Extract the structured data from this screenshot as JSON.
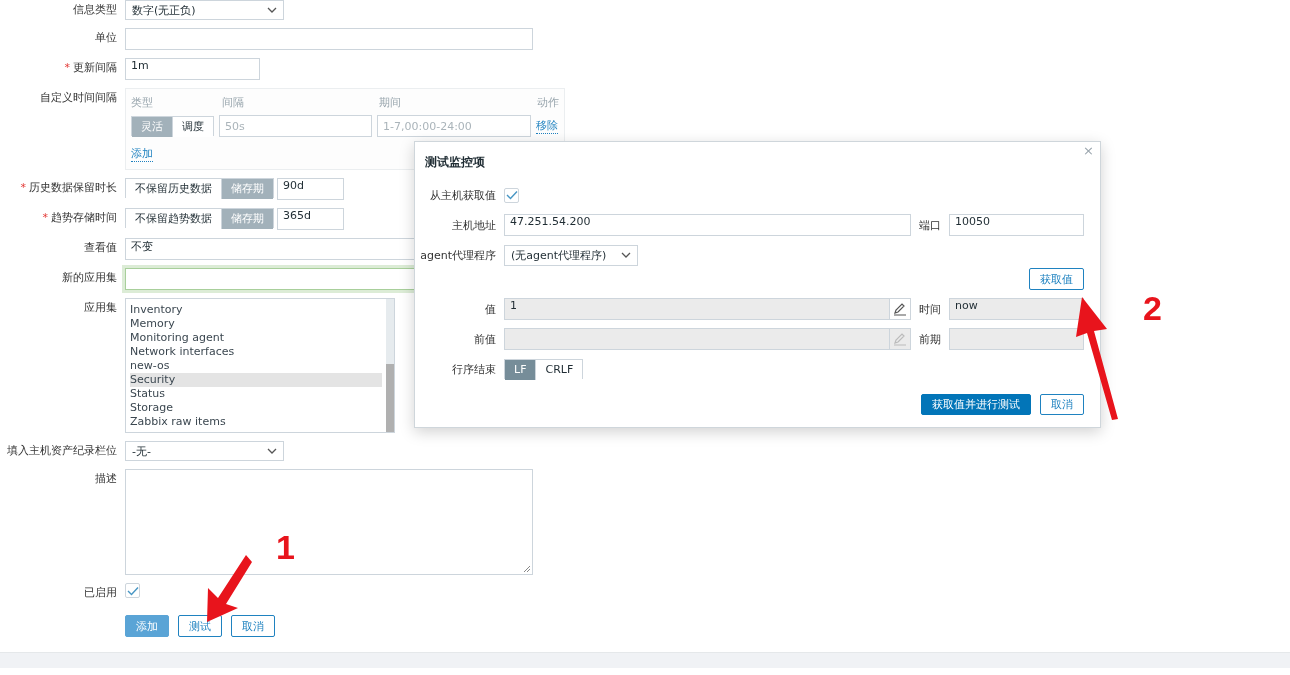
{
  "form": {
    "rows": [
      {
        "kind": "select",
        "label": "信息类型",
        "value": "数字(无正负)"
      },
      {
        "kind": "wide-input",
        "label": "单位",
        "focused": false
      },
      {
        "kind": "short-input",
        "label": "更新间隔",
        "required_mark": "*",
        "value": "1m"
      },
      {
        "kind": "intervals",
        "label": "自定义时间间隔",
        "headers": [
          "类型",
          "间隔",
          "期间",
          "动作"
        ],
        "items": [
          {
            "modes": [
              {
                "label": "灵活",
                "selected": true
              },
              {
                "label": "调度",
                "selected": false
              }
            ],
            "interval_placeholder": "50s",
            "period_placeholder": "1-7,00:00-24:00",
            "action": "移除"
          }
        ],
        "add_link": "添加"
      },
      {
        "kind": "storage",
        "label": "历史数据保留时长",
        "required_mark": "*",
        "options": [
          {
            "label": "不保留历史数据",
            "selected": false
          },
          {
            "label": "储存期",
            "selected": true
          }
        ],
        "value": "90d"
      },
      {
        "kind": "storage",
        "label": "趋势存储时间",
        "required_mark": "*",
        "options": [
          {
            "label": "不保留趋势数据",
            "selected": false
          },
          {
            "label": "储存期",
            "selected": true
          }
        ],
        "value": "365d"
      },
      {
        "kind": "wide-input",
        "label": "查看值",
        "value": "不变",
        "focused": false
      },
      {
        "kind": "wide-input",
        "label": "新的应用集",
        "focused": true
      },
      {
        "kind": "listbox",
        "label": "应用集",
        "items": [
          {
            "label": "Inventory",
            "selected": false
          },
          {
            "label": "Memory",
            "selected": false
          },
          {
            "label": "Monitoring agent",
            "selected": false
          },
          {
            "label": "Network interfaces",
            "selected": false
          },
          {
            "label": "new-os",
            "selected": false
          },
          {
            "label": "Security",
            "selected": true
          },
          {
            "label": "Status",
            "selected": false
          },
          {
            "label": "Storage",
            "selected": false
          },
          {
            "label": "Zabbix raw items",
            "selected": false
          }
        ]
      },
      {
        "kind": "select",
        "label": "填入主机资产纪录栏位",
        "value": "-无-"
      },
      {
        "kind": "textarea",
        "label": "描述"
      },
      {
        "kind": "checkbox",
        "label": "已启用",
        "checked": true
      }
    ],
    "buttons": [
      {
        "label": "添加",
        "primary": true
      },
      {
        "label": "测试",
        "primary": false
      },
      {
        "label": "取消",
        "primary": false
      }
    ]
  },
  "dialog": {
    "title": "测试监控项",
    "close": "×",
    "get_from_host": {
      "label": "从主机获取值",
      "checked": true
    },
    "host": {
      "label": "主机地址",
      "value": "47.251.54.200"
    },
    "port": {
      "label": "端口",
      "value": "10050"
    },
    "proxy": {
      "label": "agent代理程序",
      "value": "(无agent代理程序)"
    },
    "get_button": "获取值",
    "value": {
      "label": "值",
      "value": "1",
      "editable": true
    },
    "time": {
      "label": "时间",
      "value": "now"
    },
    "prev_value": {
      "label": "前值",
      "editable": false
    },
    "prev_time": {
      "label": "前期"
    },
    "eol": {
      "label": "行序结束",
      "options": [
        {
          "label": "LF",
          "selected": true
        },
        {
          "label": "CRLF",
          "selected": false
        }
      ]
    },
    "buttons": [
      {
        "label": "获取值并进行测试",
        "primary": true
      },
      {
        "label": "取消",
        "primary": false
      }
    ]
  },
  "annotations": [
    {
      "label": "1"
    },
    {
      "label": "2"
    }
  ]
}
